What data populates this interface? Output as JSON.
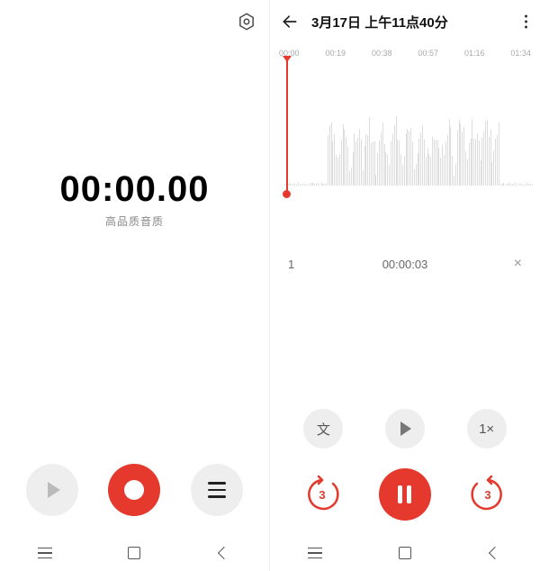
{
  "colors": {
    "accent": "#e4392c",
    "gray_btn": "#eeeeee"
  },
  "left": {
    "timer": "00:00.00",
    "quality_label": "高品质音质",
    "settings_icon": "settings-hex",
    "controls": {
      "play": "play-icon",
      "record": "record-icon",
      "list": "list-icon"
    }
  },
  "right": {
    "header": {
      "back": "back-arrow",
      "title": "3月17日 上午11点40分",
      "more": "more-vertical"
    },
    "ticks": [
      "00:00",
      "00:19",
      "00:38",
      "00:57",
      "01:16",
      "01:34"
    ],
    "mark": {
      "index": "1",
      "time": "00:00:03",
      "delete_glyph": "×"
    },
    "secondary": {
      "transcribe_label": "文",
      "play": "play-icon",
      "speed_label": "1×"
    },
    "controls": {
      "skip_back_seconds": "3",
      "pause": "pause-icon",
      "skip_fwd_seconds": "3"
    }
  },
  "nav": {
    "recents": "recents-icon",
    "home": "home-icon",
    "back": "back-icon"
  }
}
